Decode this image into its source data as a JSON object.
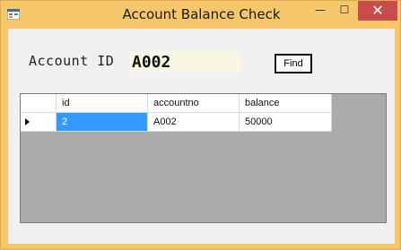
{
  "window": {
    "title": "Account Balance Check",
    "controls": {
      "minimize": "—",
      "maximize": "☐",
      "close": "✕"
    }
  },
  "form": {
    "account_label": "Account ID",
    "account_value": "A002",
    "find_label": "Find"
  },
  "grid": {
    "columns": [
      "id",
      "accountno",
      "balance"
    ],
    "rows": [
      {
        "id": "2",
        "accountno": "A002",
        "balance": "50000"
      }
    ]
  },
  "colors": {
    "accent": "#3399ff",
    "close": "#c74c4c",
    "frame": "#f5c76a"
  },
  "icons": {
    "app": "form-icon",
    "row_indicator": "current-row-arrow-icon"
  }
}
